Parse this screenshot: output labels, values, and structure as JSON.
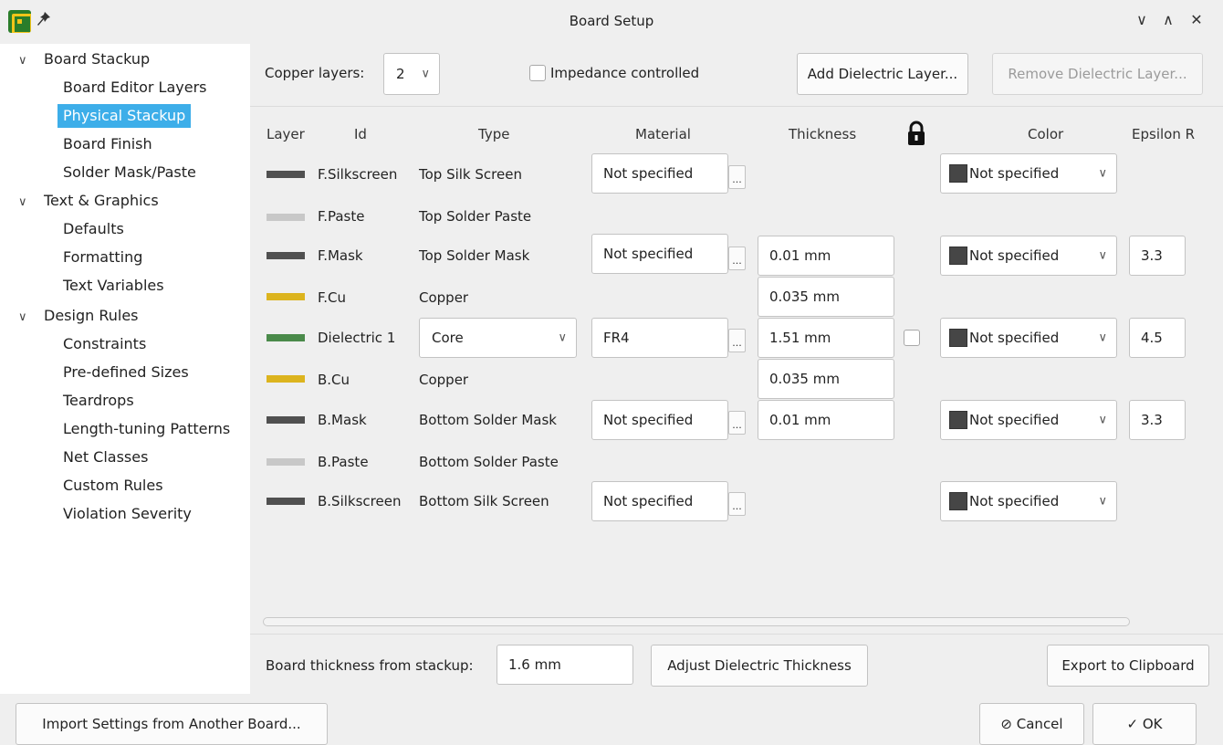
{
  "window": {
    "title": "Board Setup",
    "icons": {
      "app": "kicad-pcb-icon",
      "pin": "pin-icon"
    },
    "controls": {
      "minimize": "∨",
      "maximize": "∧",
      "close": "✕"
    }
  },
  "sidebar": {
    "sections": [
      {
        "label": "Board Stackup",
        "items": [
          "Board Editor Layers",
          "Physical Stackup",
          "Board Finish",
          "Solder Mask/Paste"
        ]
      },
      {
        "label": "Text & Graphics",
        "items": [
          "Defaults",
          "Formatting",
          "Text Variables"
        ]
      },
      {
        "label": "Design Rules",
        "items": [
          "Constraints",
          "Pre-defined Sizes",
          "Teardrops",
          "Length-tuning Patterns",
          "Net Classes",
          "Custom Rules",
          "Violation Severity"
        ]
      }
    ],
    "selected": "Physical Stackup"
  },
  "toolbar": {
    "copper_layers_label": "Copper layers:",
    "copper_layers_value": "2",
    "impedance_label": "Impedance controlled",
    "add_dielectric": "Add Dielectric Layer...",
    "remove_dielectric": "Remove Dielectric Layer..."
  },
  "table": {
    "headers": {
      "layer": "Layer",
      "id": "Id",
      "type": "Type",
      "material": "Material",
      "thickness": "Thickness",
      "color": "Color",
      "epsilon": "Epsilon R"
    },
    "rows": [
      {
        "id": "F.Silkscreen",
        "type": "Top Silk Screen",
        "swatch": "#505050",
        "material": "Not specified",
        "thickness": "",
        "color": "Not specified",
        "epsilon": ""
      },
      {
        "id": "F.Paste",
        "type": "Top Solder Paste",
        "swatch": "#c8c8c8",
        "material": "",
        "thickness": "",
        "color": "",
        "epsilon": ""
      },
      {
        "id": "F.Mask",
        "type": "Top Solder Mask",
        "swatch": "#505050",
        "material": "Not specified",
        "thickness": "0.01 mm",
        "color": "Not specified",
        "epsilon": "3.3"
      },
      {
        "id": "F.Cu",
        "type": "Copper",
        "swatch": "#dcb41e",
        "material": "",
        "thickness": "0.035 mm",
        "color": "",
        "epsilon": ""
      },
      {
        "id": "Dielectric 1",
        "type": "Core",
        "swatch": "#4a8a4a",
        "material": "FR4",
        "thickness": "1.51 mm",
        "color": "Not specified",
        "epsilon": "4.5"
      },
      {
        "id": "B.Cu",
        "type": "Copper",
        "swatch": "#dcb41e",
        "material": "",
        "thickness": "0.035 mm",
        "color": "",
        "epsilon": ""
      },
      {
        "id": "B.Mask",
        "type": "Bottom Solder Mask",
        "swatch": "#505050",
        "material": "Not specified",
        "thickness": "0.01 mm",
        "color": "Not specified",
        "epsilon": "3.3"
      },
      {
        "id": "B.Paste",
        "type": "Bottom Solder Paste",
        "swatch": "#c8c8c8",
        "material": "",
        "thickness": "",
        "color": "",
        "epsilon": ""
      },
      {
        "id": "B.Silkscreen",
        "type": "Bottom Silk Screen",
        "swatch": "#505050",
        "material": "Not specified",
        "thickness": "",
        "color": "Not specified",
        "epsilon": ""
      }
    ]
  },
  "footer": {
    "thickness_label": "Board thickness from stackup:",
    "thickness_value": "1.6 mm",
    "adjust_button": "Adjust Dielectric Thickness",
    "export_button": "Export to Clipboard"
  },
  "dialog": {
    "import_button": "Import Settings from Another Board...",
    "cancel_button": "Cancel",
    "ok_button": "OK"
  }
}
